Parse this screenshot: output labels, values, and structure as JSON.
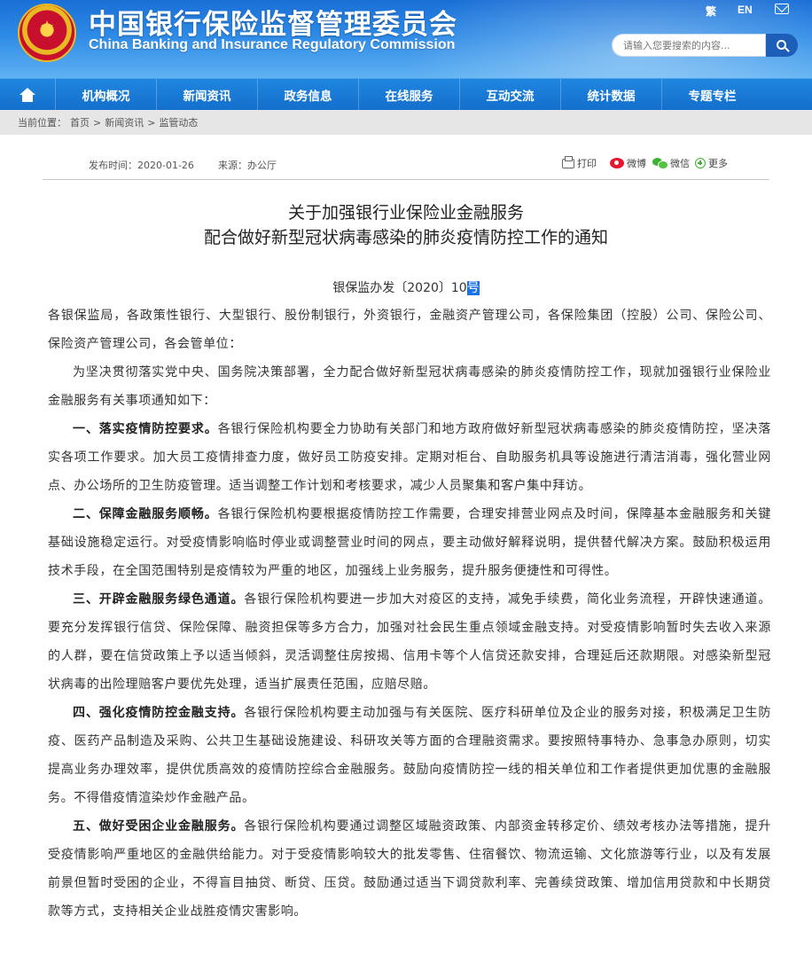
{
  "header": {
    "title_cn": "中国银行保险监督管理委员会",
    "title_en": "China Banking and Insurance Regulatory Commission",
    "lang_trad": "繁",
    "lang_en": "EN",
    "search_placeholder": "请输入您要搜索的内容..."
  },
  "nav": {
    "items": [
      {
        "label": "机构概况"
      },
      {
        "label": "新闻资讯"
      },
      {
        "label": "政务信息"
      },
      {
        "label": "在线服务"
      },
      {
        "label": "互动交流"
      },
      {
        "label": "统计数据"
      },
      {
        "label": "专题专栏"
      }
    ]
  },
  "breadcrumb": {
    "prefix": "当前位置：",
    "items": [
      "首页",
      "新闻资讯",
      "监管动态"
    ],
    "sep": ">"
  },
  "meta": {
    "date": "发布时间：2020-01-26",
    "source": "来源：办公厅",
    "share": {
      "print": "打印",
      "weibo": "微博",
      "wechat": "微信",
      "more": "更多"
    }
  },
  "article": {
    "title_line1": "关于加强银行业保险业金融服务",
    "title_line2": "配合做好新型冠状病毒感染的肺炎疫情防控工作的通知",
    "doc_number_prefix": "银保监办发〔2020〕10",
    "doc_number_suffix": "号",
    "addressee": "各银保监局，各政策性银行、大型银行、股份制银行，外资银行，金融资产管理公司，各保险集团（控股）公司、保险公司、保险资产管理公司，各会管单位：",
    "intro": "为坚决贯彻落实党中央、国务院决策部署，全力配合做好新型冠状病毒感染的肺炎疫情防控工作，现就加强银行业保险业金融服务有关事项通知如下：",
    "sections": [
      {
        "heading": "一、落实疫情防控要求。",
        "text": "各银行保险机构要全力协助有关部门和地方政府做好新型冠状病毒感染的肺炎疫情防控，坚决落实各项工作要求。加大员工疫情排查力度，做好员工防疫安排。定期对柜台、自助服务机具等设施进行清洁消毒，强化营业网点、办公场所的卫生防疫管理。适当调整工作计划和考核要求，减少人员聚集和客户集中拜访。"
      },
      {
        "heading": "二、保障金融服务顺畅。",
        "text": "各银行保险机构要根据疫情防控工作需要，合理安排营业网点及时间，保障基本金融服务和关键基础设施稳定运行。对受疫情影响临时停业或调整营业时间的网点，要主动做好解释说明，提供替代解决方案。鼓励积极运用技术手段，在全国范围特别是疫情较为严重的地区，加强线上业务服务，提升服务便捷性和可得性。"
      },
      {
        "heading": "三、开辟金融服务绿色通道。",
        "text": "各银行保险机构要进一步加大对疫区的支持，减免手续费，简化业务流程，开辟快速通道。要充分发挥银行信贷、保险保障、融资担保等多方合力，加强对社会民生重点领域金融支持。对受疫情影响暂时失去收入来源的人群，要在信贷政策上予以适当倾斜，灵活调整住房按揭、信用卡等个人信贷还款安排，合理延后还款期限。对感染新型冠状病毒的出险理赔客户要优先处理，适当扩展责任范围，应赔尽赔。"
      },
      {
        "heading": "四、强化疫情防控金融支持。",
        "text": "各银行保险机构要主动加强与有关医院、医疗科研单位及企业的服务对接，积极满足卫生防疫、医药产品制造及采购、公共卫生基础设施建设、科研攻关等方面的合理融资需求。要按照特事特办、急事急办原则，切实提高业务办理效率，提供优质高效的疫情防控综合金融服务。鼓励向疫情防控一线的相关单位和工作者提供更加优惠的金融服务。不得借疫情渲染炒作金融产品。"
      },
      {
        "heading": "五、做好受困企业金融服务。",
        "text": "各银行保险机构要通过调整区域融资政策、内部资金转移定价、绩效考核办法等措施，提升受疫情影响严重地区的金融供给能力。对于受疫情影响较大的批发零售、住宿餐饮、物流运输、文化旅游等行业，以及有发展前景但暂时受困的企业，不得盲目抽贷、断贷、压贷。鼓励通过适当下调贷款利率、完善续贷政策、增加信用贷款和中长期贷款等方式，支持相关企业战胜疫情灾害影响。"
      }
    ]
  }
}
